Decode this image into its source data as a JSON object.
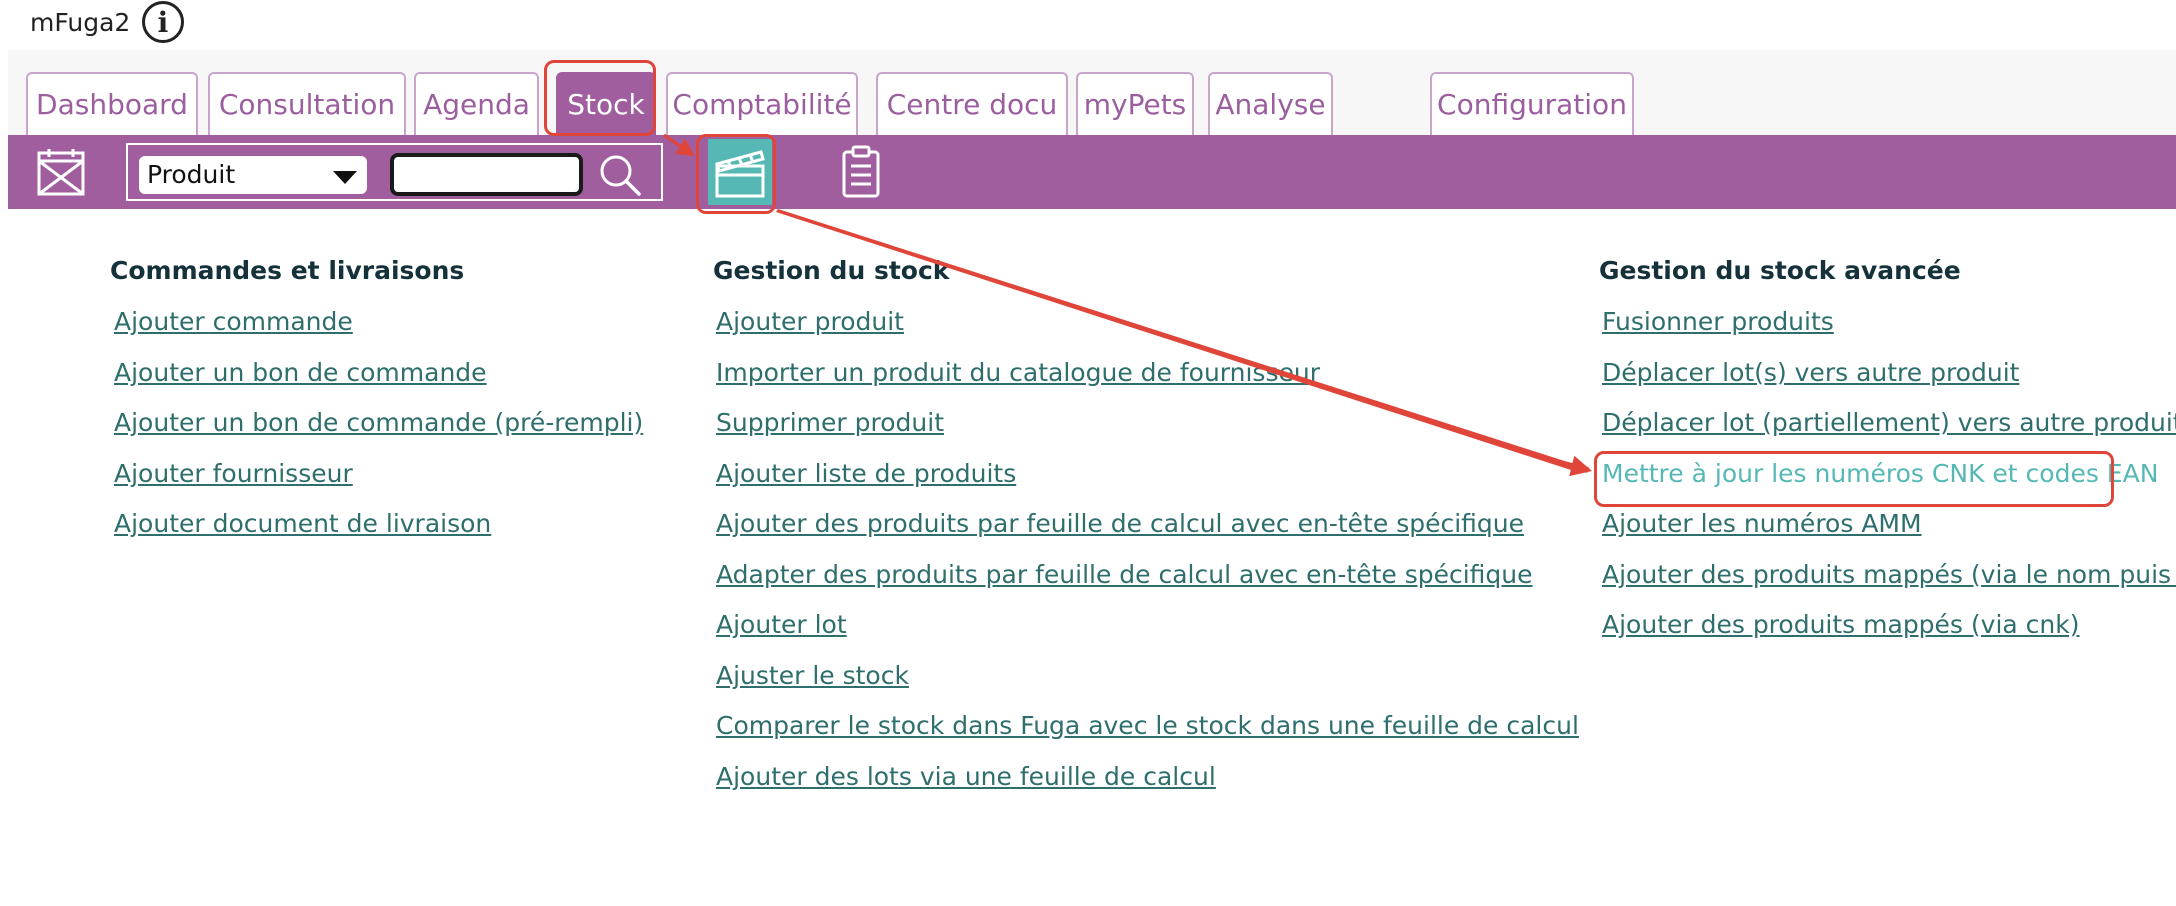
{
  "app": {
    "name": "mFuga2",
    "info_icon": "info-icon"
  },
  "tabs": [
    {
      "label": "Dashboard",
      "active": false
    },
    {
      "label": "Consultation",
      "active": false
    },
    {
      "label": "Agenda",
      "active": false
    },
    {
      "label": "Stock",
      "active": true
    },
    {
      "label": "Comptabilité",
      "active": false
    },
    {
      "label": "Centre docu",
      "active": false
    },
    {
      "label": "myPets",
      "active": false
    },
    {
      "label": "Analyse",
      "active": false
    },
    {
      "label": "Configuration",
      "active": false
    }
  ],
  "toolbar": {
    "search_type": "Produit",
    "search_value": "",
    "icons": [
      "calendar-x-icon",
      "search-icon",
      "clapperboard-icon",
      "clipboard-icon"
    ]
  },
  "sections": [
    {
      "title": "Commandes et livraisons",
      "links": [
        "Ajouter commande",
        "Ajouter un bon de commande",
        "Ajouter un bon de commande (pré-rempli)",
        "Ajouter fournisseur",
        "Ajouter document de livraison"
      ]
    },
    {
      "title": "Gestion du stock",
      "links": [
        "Ajouter produit",
        "Importer un produit du catalogue de fournisseur",
        "Supprimer produit",
        "Ajouter liste de produits",
        "Ajouter des produits par feuille de calcul avec en-tête spécifique",
        "Adapter des produits par feuille de calcul avec en-tête spécifique",
        "Ajouter lot",
        "Ajuster le stock",
        "Comparer le stock dans Fuga avec le stock dans une feuille de calcul",
        "Ajouter des lots via une feuille de calcul"
      ]
    },
    {
      "title": "Gestion du stock avancée",
      "links": [
        "Fusionner produits",
        "Déplacer lot(s) vers autre produit",
        "Déplacer lot (partiellement) vers autre produit",
        "Mettre à jour les numéros CNK et codes EAN",
        "Ajouter les numéros AMM",
        "Ajouter des produits mappés (via le nom puis cnk)",
        "Ajouter des produits mappés (via cnk)"
      ]
    }
  ],
  "colors": {
    "brand_purple": "#a05e9f",
    "link_teal": "#2e6e6c",
    "highlight_teal": "#55b8b5",
    "annotation_red": "#e0453a"
  }
}
